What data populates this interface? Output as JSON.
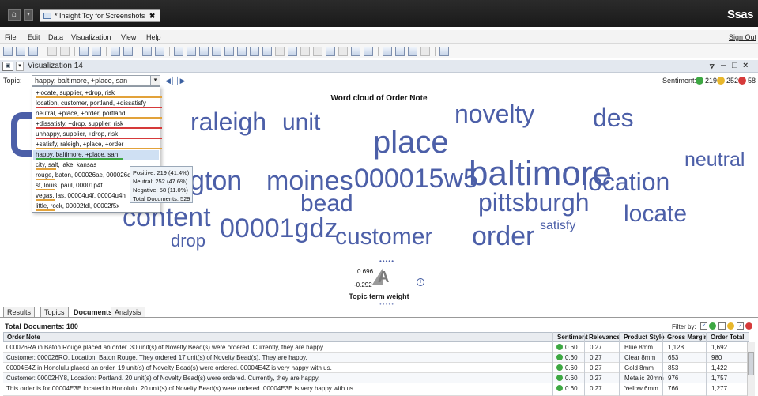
{
  "titlebar": {
    "doc_tab": "* Insight Toy for Screenshots",
    "close_glyph": "✖",
    "brand": "Ssas",
    "home_icon": "home-icon"
  },
  "menu": {
    "items": [
      "File",
      "Edit",
      "Data",
      "Visualization",
      "View",
      "Help"
    ],
    "sign_out": "Sign Out"
  },
  "visualization": {
    "title": "Visualization 14",
    "window_controls": [
      "▿",
      "‒",
      "□",
      "×"
    ]
  },
  "topic": {
    "label": "Topic:",
    "selected": "happy, baltimore, +place, san",
    "options": [
      {
        "text": "+locate, supplier, +drop, risk",
        "bar": "#e2a23a"
      },
      {
        "text": "location, customer, portland, +dissatisfy",
        "bar": "#d63a3a"
      },
      {
        "text": "neutral, +place, +order, portland",
        "bar": "#e2a23a"
      },
      {
        "text": "+dissatisfy, +drop, supplier, risk",
        "bar": "#d63a3a"
      },
      {
        "text": "unhappy, supplier, +drop, risk",
        "bar": "#d63a3a"
      },
      {
        "text": "+satisfy, raleigh, +place, +order",
        "bar": "#e2a23a"
      },
      {
        "text": "happy, baltimore, +place, san",
        "bar": "#3ea843"
      },
      {
        "text": "city, salt, lake, kansas",
        "bar": "#e2a23a"
      },
      {
        "text": "rouge, baton, 000026ae, 000026dc",
        "bar": "#e2a23a"
      },
      {
        "text": "st, louis, paul, 00001p4f",
        "bar": "#e2a23a"
      },
      {
        "text": "vegas, las, 00004u4f, 00004u4h",
        "bar": "#e2a23a"
      },
      {
        "text": "little, rock, 00002fdl, 00002f5x",
        "bar": "#e2a23a"
      }
    ]
  },
  "tooltip": {
    "positive": "Positive: 219 (41.4%)",
    "neutral": "Neutral: 252 (47.6%)",
    "negative": "Negative: 58 (11.0%)",
    "total": "Total Documents: 529"
  },
  "sentiment": {
    "label": "Sentiment:",
    "positive": "219",
    "neutral": "252",
    "negative": "58",
    "colors": {
      "positive": "#3ea843",
      "neutral": "#e8b72c",
      "negative": "#d63a3a"
    }
  },
  "wordcloud": {
    "title": "Word cloud of Order Note",
    "words": [
      {
        "text": "raleigh"
      },
      {
        "text": "unit"
      },
      {
        "text": "novelty"
      },
      {
        "text": "des"
      },
      {
        "text": "place"
      },
      {
        "text": "neutral"
      },
      {
        "text": "gton"
      },
      {
        "text": "moines"
      },
      {
        "text": "000015w5"
      },
      {
        "text": "baltimore"
      },
      {
        "text": "location"
      },
      {
        "text": "bead"
      },
      {
        "text": "pittsburgh"
      },
      {
        "text": "content"
      },
      {
        "text": "00001gdz"
      },
      {
        "text": "customer"
      },
      {
        "text": "order"
      },
      {
        "text": "satisfy"
      },
      {
        "text": "locate"
      },
      {
        "text": "drop"
      }
    ],
    "color": "#4c5fa8"
  },
  "legend": {
    "max": "0.696",
    "min": "-0.292",
    "title": "Topic term weight",
    "dots": "•••••",
    "glyph": "A",
    "info_icon": "i"
  },
  "tabs": [
    "Results",
    "Topics",
    "Documents",
    "Analysis"
  ],
  "documents": {
    "total": "Total Documents: 180",
    "filter_label": "Filter by:",
    "check_glyph": "✓",
    "columns": [
      "Order Note",
      "Sentiment",
      "Relevance",
      "Product Style",
      "Gross Margin",
      "Order Total"
    ],
    "rows": [
      {
        "note": "000026RA in Baton Rouge placed an order. 30 unit(s) of Novelty Bead(s) were ordered. Currently, they are happy.",
        "sentiment": "0.60",
        "relevance": "0.27",
        "style": "Blue 8mm",
        "margin": "1,128",
        "total": "1,692"
      },
      {
        "note": "Customer: 000026RO, Location: Baton Rouge. They ordered 17 unit(s) of Novelty Bead(s). They are happy.",
        "sentiment": "0.60",
        "relevance": "0.27",
        "style": "Clear 8mm",
        "margin": "653",
        "total": "980"
      },
      {
        "note": "00004E4Z in Honolulu placed an order. 19 unit(s) of Novelty Bead(s) were ordered. 00004E4Z is very happy with us.",
        "sentiment": "0.60",
        "relevance": "0.27",
        "style": "Gold 8mm",
        "margin": "853",
        "total": "1,422"
      },
      {
        "note": "Customer: 00002HY8, Location: Portland. 20 unit(s) of Novelty Bead(s) were ordered. Currently, they are happy.",
        "sentiment": "0.60",
        "relevance": "0.27",
        "style": "Metalic 20mm",
        "margin": "976",
        "total": "1,757"
      },
      {
        "note": "This order is for 00004E3E located in Honolulu. 20 unit(s) of Novelty Bead(s) were ordered. 00004E3E is very happy with us.",
        "sentiment": "0.60",
        "relevance": "0.27",
        "style": "Yellow 6mm",
        "margin": "766",
        "total": "1,277"
      }
    ]
  }
}
